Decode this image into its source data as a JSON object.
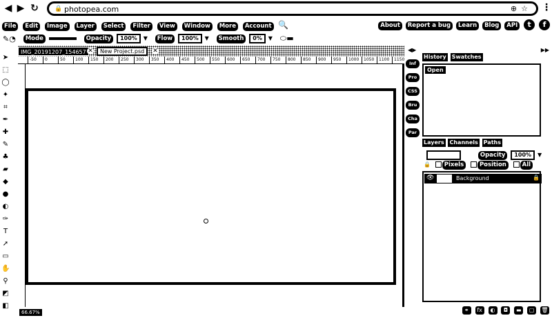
{
  "browser": {
    "url": "photopea.com",
    "back": "◀",
    "forward": "▶",
    "reload": "↻"
  },
  "menu": {
    "items": [
      "File",
      "Edit",
      "Image",
      "Layer",
      "Select",
      "Filter",
      "View",
      "Window",
      "More",
      "Account"
    ],
    "right_items": [
      "About",
      "Report a bug",
      "Learn",
      "Blog",
      "API"
    ]
  },
  "tool_options": {
    "mode_label": "Mode",
    "mode_value": "",
    "opacity_label": "Opacity",
    "opacity_value": "100%",
    "flow_label": "Flow",
    "flow_value": "100%",
    "smooth_label": "Smooth",
    "smooth_value": "0%"
  },
  "tabs": [
    {
      "label": "IMG_20191207_154657",
      "active": true
    },
    {
      "label": "New Project.psd",
      "active": false
    }
  ],
  "ruler": {
    "ticks": [
      "-50",
      "0",
      "50",
      "100",
      "150",
      "200",
      "250",
      "300",
      "350",
      "400",
      "450",
      "500",
      "550",
      "600",
      "650",
      "700",
      "750",
      "800",
      "850",
      "900",
      "950",
      "1000",
      "1050",
      "1100",
      "1150"
    ]
  },
  "status": {
    "zoom": "66.67%"
  },
  "mini_panels": [
    "Inf",
    "Pro",
    "CSS",
    "Bru",
    "Cha",
    "Par"
  ],
  "history_panel": {
    "tabs": [
      "History",
      "Swatches"
    ],
    "items": [
      "Open"
    ]
  },
  "layers_panel": {
    "tabs": [
      "Layers",
      "Channels",
      "Paths"
    ],
    "opacity_label": "Opacity",
    "opacity_value": "100%",
    "lock_pixels": "Pixels",
    "lock_position": "Position",
    "lock_all": "All",
    "layers": [
      {
        "name": "Background",
        "visible": true,
        "locked": true
      }
    ]
  }
}
